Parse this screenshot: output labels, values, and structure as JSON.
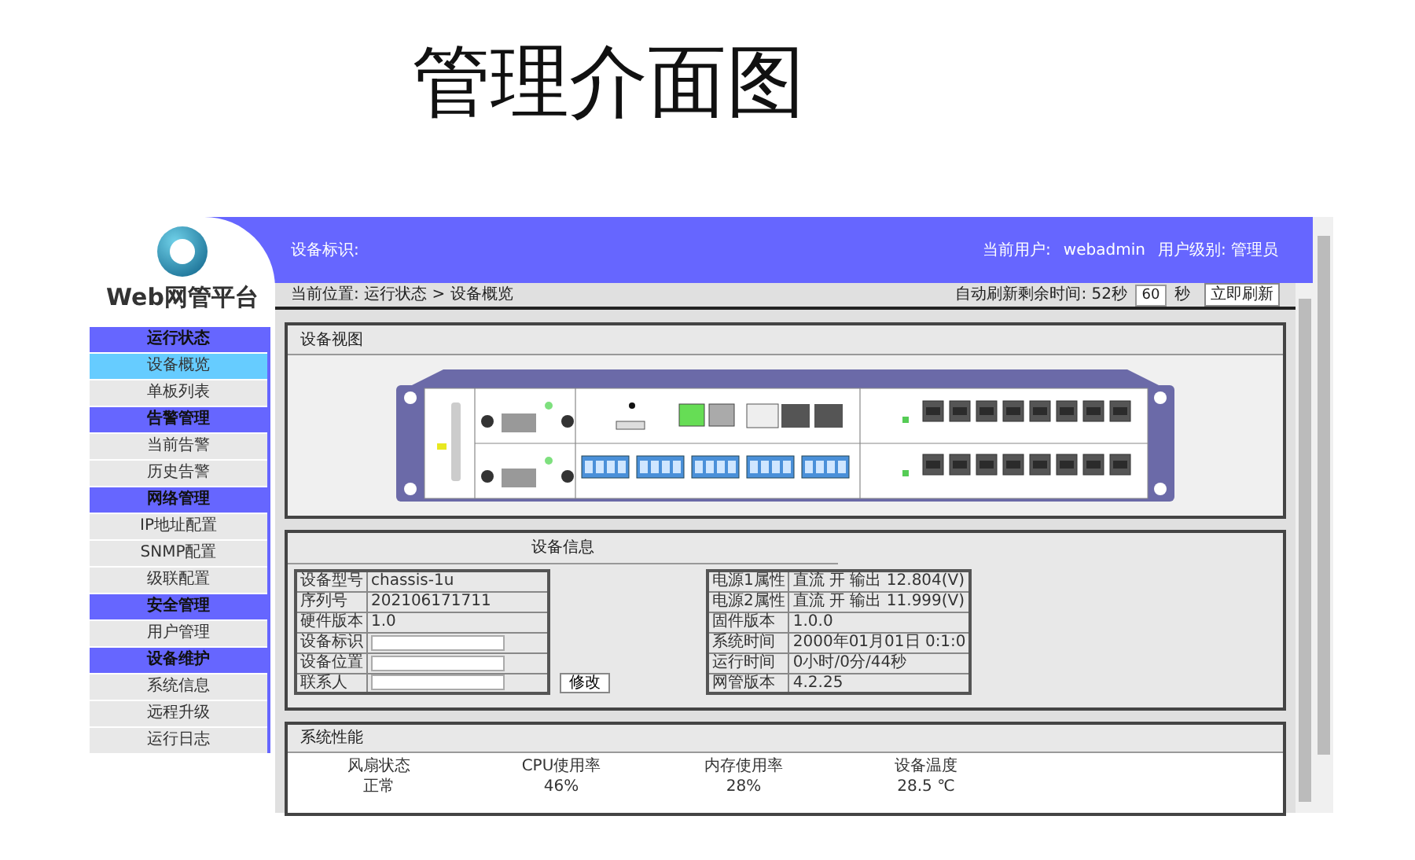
{
  "page_title": "管理介面图",
  "logo_text": "Web网管平台",
  "sidebar": [
    {
      "label": "运行状态",
      "items": [
        {
          "label": "设备概览",
          "selected": true
        },
        {
          "label": "单板列表",
          "selected": false
        }
      ]
    },
    {
      "label": "告警管理",
      "items": [
        {
          "label": "当前告警",
          "selected": false
        },
        {
          "label": "历史告警",
          "selected": false
        }
      ]
    },
    {
      "label": "网络管理",
      "items": [
        {
          "label": "IP地址配置",
          "selected": false
        },
        {
          "label": "SNMP配置",
          "selected": false
        },
        {
          "label": "级联配置",
          "selected": false
        }
      ]
    },
    {
      "label": "安全管理",
      "items": [
        {
          "label": "用户管理",
          "selected": false
        }
      ]
    },
    {
      "label": "设备维护",
      "items": [
        {
          "label": "系统信息",
          "selected": false
        },
        {
          "label": "远程升级",
          "selected": false
        },
        {
          "label": "运行日志",
          "selected": false
        }
      ]
    }
  ],
  "header": {
    "device_label": "设备标识:",
    "user_label": "当前用户:",
    "user": "webadmin",
    "level": "用户级别: 管理员"
  },
  "breadcrumb": "当前位置: 运行状态 > 设备概览",
  "refresh": {
    "label": "自动刷新剩余时间: 52秒",
    "interval": "60",
    "unit": "秒",
    "button": "立即刷新"
  },
  "device_view": {
    "title": "设备视图"
  },
  "device_info": {
    "title": "设备信息",
    "left_rows": [
      {
        "label": "设备型号",
        "kind": "text",
        "value": "chassis-1u"
      },
      {
        "label": "序列号",
        "kind": "text",
        "value": "202106171711"
      },
      {
        "label": "硬件版本",
        "kind": "text",
        "value": "1.0"
      },
      {
        "label": "设备标识",
        "kind": "input"
      },
      {
        "label": "设备位置",
        "kind": "input"
      },
      {
        "label": "联系人",
        "kind": "input"
      }
    ],
    "button": "修改",
    "right_rows": [
      {
        "label": "电源1属性",
        "value": "直流 开 输出 12.804(V)"
      },
      {
        "label": "电源2属性",
        "value": "直流 开 输出 11.999(V)"
      },
      {
        "label": "固件版本",
        "value": "1.0.0"
      },
      {
        "label": "系统时间",
        "value": "2000年01月01日 0:1:0"
      },
      {
        "label": "运行时间",
        "value": "0小时/0分/44秒"
      },
      {
        "label": "网管版本",
        "value": "4.2.25"
      }
    ]
  },
  "performance": {
    "title": "系统性能",
    "metrics": [
      {
        "label": "风扇状态",
        "value": "正常"
      },
      {
        "label": "CPU使用率",
        "value": "46%"
      },
      {
        "label": "内存使用率",
        "value": "28%"
      },
      {
        "label": "设备温度",
        "value": "28.5 ℃"
      }
    ]
  }
}
